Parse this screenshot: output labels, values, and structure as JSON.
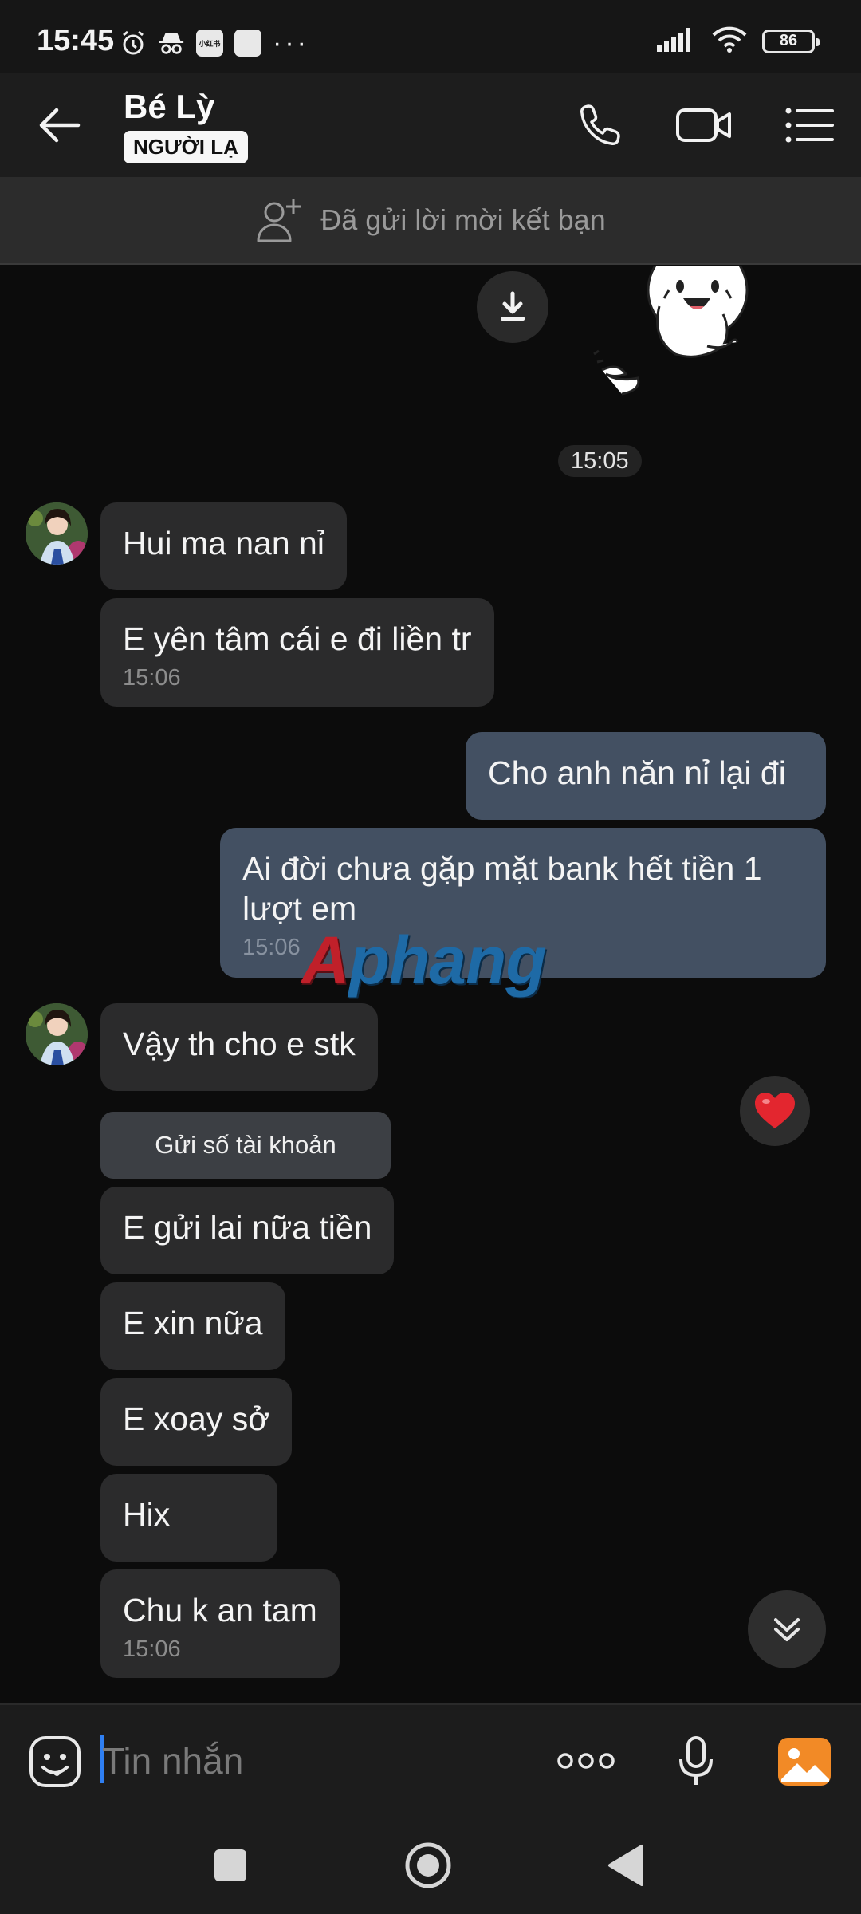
{
  "status_bar": {
    "time": "15:45",
    "battery": "86",
    "app_icon_label": "小红书",
    "more": "···"
  },
  "header": {
    "contact_name": "Bé Lỳ",
    "badge": "NGƯỜI LẠ"
  },
  "friend_banner": {
    "text": "Đã gửi lời mời kết bạn"
  },
  "chat": {
    "sticker_time": "15:05",
    "messages": [
      {
        "side": "in",
        "text": "Hui ma nan nỉ",
        "time": ""
      },
      {
        "side": "in",
        "text": "E yên tâm cái e đi liền tr",
        "time": "15:06"
      },
      {
        "side": "out",
        "text": "Cho anh năn nỉ lại đi",
        "time": ""
      },
      {
        "side": "out",
        "text": "Ai đời chưa gặp mặt bank hết tiền 1 lượt em",
        "time": "15:06"
      },
      {
        "side": "in",
        "text": "Vậy th cho e stk",
        "time": ""
      },
      {
        "side": "in",
        "text": "E gửi lai nữa tiền",
        "time": ""
      },
      {
        "side": "in",
        "text": "E xin nữa",
        "time": ""
      },
      {
        "side": "in",
        "text": "E xoay sở",
        "time": ""
      },
      {
        "side": "in",
        "text": "Hix",
        "time": ""
      },
      {
        "side": "in",
        "text": "Chu k an tam",
        "time": "15:06"
      }
    ],
    "account_card_button": "Gửi số tài khoản",
    "watermark_first": "A",
    "watermark_rest": "phang"
  },
  "input_bar": {
    "placeholder": "Tin nhắn"
  },
  "colors": {
    "incoming_bubble": "#2b2b2c",
    "outgoing_bubble": "#435062",
    "accent_caret": "#2f7ff2",
    "image_button": "#f28a26",
    "heart": "#e3262f"
  },
  "icons": [
    "alarm-icon",
    "incognito-icon",
    "app-icon",
    "dots-icon",
    "signal-icon",
    "wifi-icon",
    "battery-icon",
    "back-arrow-icon",
    "phone-icon",
    "video-camera-icon",
    "menu-list-icon",
    "add-friend-icon",
    "download-icon",
    "heart-icon",
    "double-chevron-down-icon",
    "emoji-icon",
    "more-dots-icon",
    "microphone-icon",
    "image-icon",
    "square-icon",
    "circle-icon",
    "triangle-back-icon"
  ]
}
